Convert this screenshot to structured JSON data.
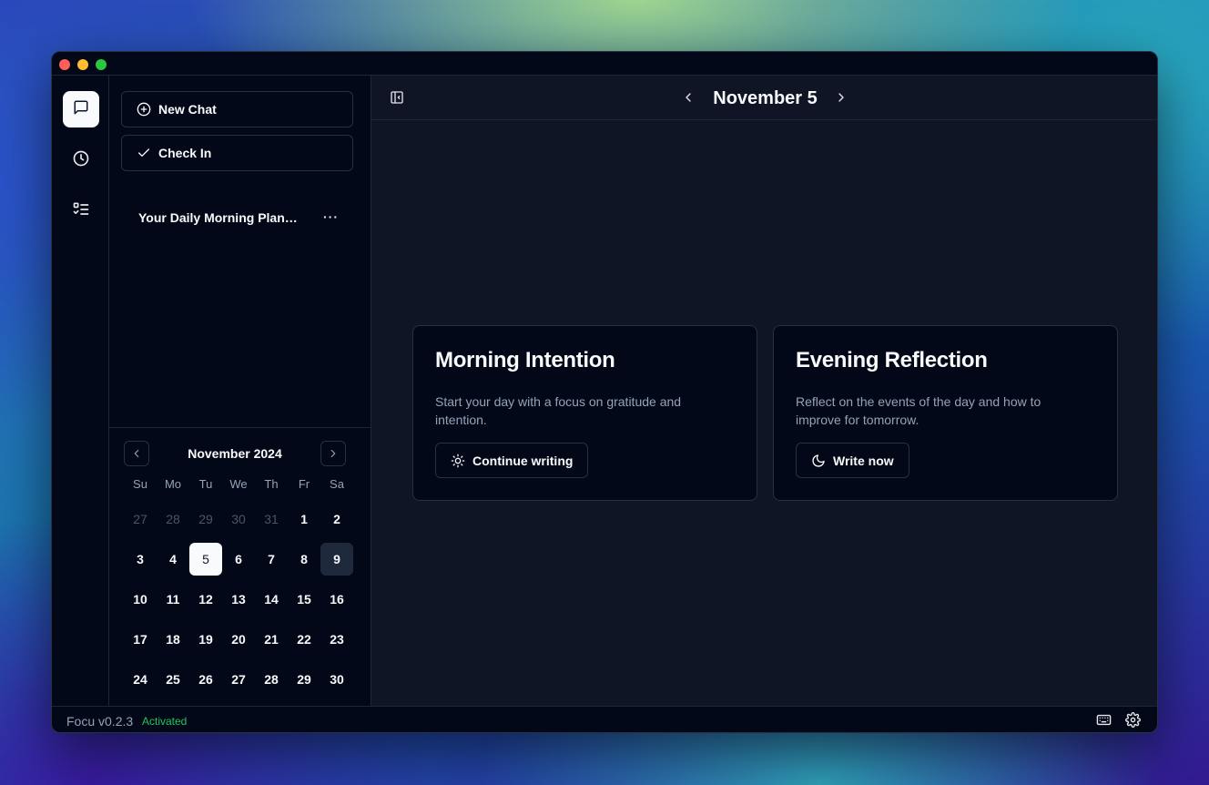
{
  "app": {
    "version": "Focu v0.2.3",
    "status": "Activated"
  },
  "rail": {
    "icons": [
      "chat-icon",
      "history-icon",
      "checklist-icon"
    ]
  },
  "sidebar": {
    "new_chat": "New Chat",
    "check_in": "Check In",
    "chat_items": [
      {
        "title": "Your Daily Morning Planning"
      }
    ],
    "more_glyph": "···"
  },
  "calendar": {
    "month_label": "November 2024",
    "weekdays": [
      "Su",
      "Mo",
      "Tu",
      "We",
      "Th",
      "Fr",
      "Sa"
    ],
    "weeks": [
      [
        {
          "d": "27",
          "m": true
        },
        {
          "d": "28",
          "m": true
        },
        {
          "d": "29",
          "m": true
        },
        {
          "d": "30",
          "m": true
        },
        {
          "d": "31",
          "m": true
        },
        {
          "d": "1"
        },
        {
          "d": "2"
        }
      ],
      [
        {
          "d": "3"
        },
        {
          "d": "4"
        },
        {
          "d": "5",
          "sel": true
        },
        {
          "d": "6"
        },
        {
          "d": "7"
        },
        {
          "d": "8"
        },
        {
          "d": "9",
          "today": true
        }
      ],
      [
        {
          "d": "10"
        },
        {
          "d": "11"
        },
        {
          "d": "12"
        },
        {
          "d": "13"
        },
        {
          "d": "14"
        },
        {
          "d": "15"
        },
        {
          "d": "16"
        }
      ],
      [
        {
          "d": "17"
        },
        {
          "d": "18"
        },
        {
          "d": "19"
        },
        {
          "d": "20"
        },
        {
          "d": "21"
        },
        {
          "d": "22"
        },
        {
          "d": "23"
        }
      ],
      [
        {
          "d": "24"
        },
        {
          "d": "25"
        },
        {
          "d": "26"
        },
        {
          "d": "27"
        },
        {
          "d": "28"
        },
        {
          "d": "29"
        },
        {
          "d": "30"
        }
      ]
    ]
  },
  "main": {
    "date_label": "November 5",
    "cards": [
      {
        "title": "Morning Intention",
        "description": "Start your day with a focus on gratitude and intention.",
        "button": "Continue writing",
        "icon": "sun-icon"
      },
      {
        "title": "Evening Reflection",
        "description": "Reflect on the events of the day and how to improve for tomorrow.",
        "button": "Write now",
        "icon": "moon-icon"
      }
    ]
  },
  "colors": {
    "accent_status": "#22c55e",
    "background": "#020817",
    "panel": "#0f1524"
  }
}
